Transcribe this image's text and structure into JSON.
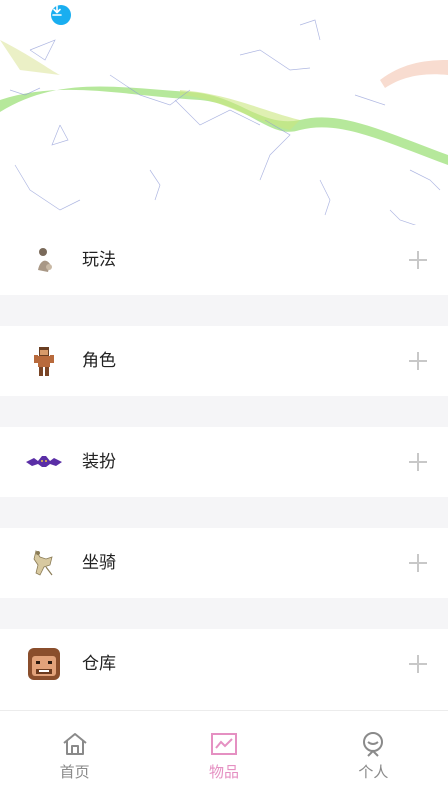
{
  "banner": {
    "download_icon": "download-icon"
  },
  "list": {
    "items": [
      {
        "label": "玩法",
        "icon": "gameplay-figure-icon"
      },
      {
        "label": "角色",
        "icon": "character-icon"
      },
      {
        "label": "装扮",
        "icon": "costume-bat-icon"
      },
      {
        "label": "坐骑",
        "icon": "mount-icon"
      },
      {
        "label": "仓库",
        "icon": "warehouse-face-icon"
      }
    ],
    "expand_icon": "plus-icon"
  },
  "tabbar": {
    "tabs": [
      {
        "label": "首页",
        "icon": "home-icon",
        "active": false
      },
      {
        "label": "物品",
        "icon": "items-chart-icon",
        "active": true
      },
      {
        "label": "个人",
        "icon": "profile-icon",
        "active": false
      }
    ],
    "colors": {
      "active": "#e590c2",
      "inactive": "#8a8a8a"
    }
  }
}
